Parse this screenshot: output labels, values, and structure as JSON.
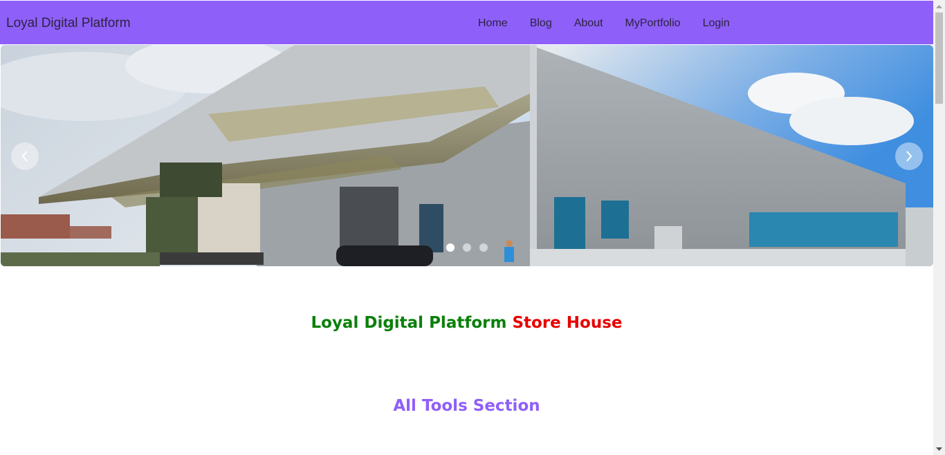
{
  "navbar": {
    "brand": "Loyal Digital Platform",
    "links": [
      "Home",
      "Blog",
      "About",
      "MyPortfolio",
      "Login"
    ],
    "background_color": "#8f5ff9"
  },
  "carousel": {
    "slide_count": 3,
    "active_slide": 1,
    "prev_icon": "chevron-left-icon",
    "next_icon": "chevron-right-icon"
  },
  "headline": {
    "part1": "Loyal Digital Platform",
    "part2": "Store House",
    "part1_color": "#0a800a",
    "part2_color": "#e60000"
  },
  "section": {
    "title": "All Tools Section",
    "color": "#8f5ff9"
  }
}
